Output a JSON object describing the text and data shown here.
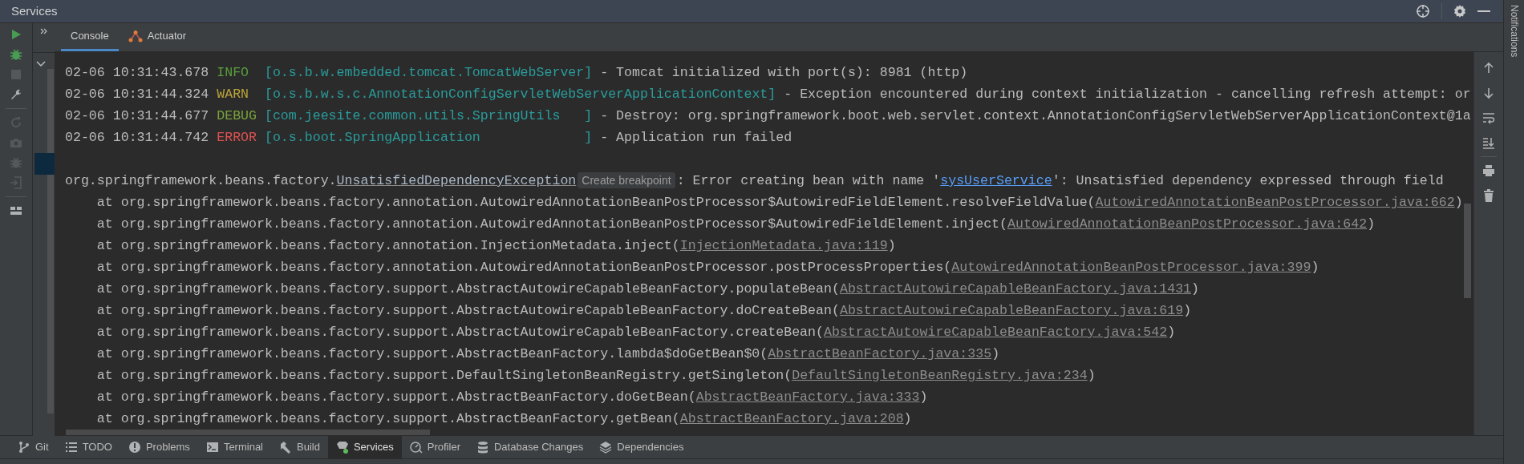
{
  "window": {
    "title": "Services"
  },
  "left_toolbar": [
    {
      "kind": "run",
      "disabled": false
    },
    {
      "kind": "debug",
      "disabled": false
    },
    {
      "kind": "stop",
      "disabled": true
    },
    {
      "kind": "wrench",
      "disabled": false
    },
    {
      "kind": "separator"
    },
    {
      "kind": "rerun",
      "disabled": true
    },
    {
      "kind": "camera",
      "disabled": true
    },
    {
      "kind": "debug",
      "disabled": true
    },
    {
      "kind": "import",
      "disabled": true
    },
    {
      "kind": "separator"
    },
    {
      "kind": "layout",
      "disabled": false
    }
  ],
  "tabs": [
    {
      "label": "Console",
      "kind": "console",
      "selected": true
    },
    {
      "label": "Actuator",
      "kind": "actuator",
      "selected": false
    }
  ],
  "console": {
    "lines": [
      {
        "kind": "log",
        "time": "02-06 10:31:43.678",
        "level": "INFO",
        "logger": "[o.s.b.w.embedded.tomcat.TomcatWebServer]",
        "message": "- Tomcat initialized with port(s): 8981 (http)"
      },
      {
        "kind": "log",
        "time": "02-06 10:31:44.324",
        "level": "WARN",
        "logger": "[o.s.b.w.s.c.AnnotationConfigServletWebServerApplicationContext]",
        "message": "- Exception encountered during context initialization - cancelling refresh attempt: or"
      },
      {
        "kind": "log",
        "time": "02-06 10:31:44.677",
        "level": "DEBUG",
        "logger": "[com.jeesite.common.utils.SpringUtils   ]",
        "message": "- Destroy: org.springframework.boot.web.servlet.context.AnnotationConfigServletWebServerApplicationContext@1a"
      },
      {
        "kind": "log",
        "time": "02-06 10:31:44.742",
        "level": "ERROR",
        "logger": "[o.s.boot.SpringApplication             ]",
        "message": "- Application run failed"
      },
      {
        "kind": "blank"
      },
      {
        "kind": "exception",
        "parts": [
          {
            "kind": "text",
            "text": "org.springframework.beans.factory."
          },
          {
            "kind": "class_link",
            "text": "UnsatisfiedDependencyException"
          },
          {
            "kind": "hint",
            "text": "Create breakpoint"
          },
          {
            "kind": "text",
            "text": ": Error creating bean with name '"
          },
          {
            "kind": "bean_link",
            "text": "sysUserService"
          },
          {
            "kind": "text",
            "text": "': Unsatisfied dependency expressed through field"
          }
        ]
      },
      {
        "kind": "frame",
        "prefix": "at org.springframework.beans.factory.annotation.AutowiredAnnotationBeanPostProcessor$AutowiredFieldElement.resolveFieldValue(",
        "link": "AutowiredAnnotationBeanPostProcessor.java:662",
        "suffix": ")"
      },
      {
        "kind": "frame",
        "prefix": "at org.springframework.beans.factory.annotation.AutowiredAnnotationBeanPostProcessor$AutowiredFieldElement.inject(",
        "link": "AutowiredAnnotationBeanPostProcessor.java:642",
        "suffix": ")"
      },
      {
        "kind": "frame",
        "prefix": "at org.springframework.beans.factory.annotation.InjectionMetadata.inject(",
        "link": "InjectionMetadata.java:119",
        "suffix": ")"
      },
      {
        "kind": "frame",
        "prefix": "at org.springframework.beans.factory.annotation.AutowiredAnnotationBeanPostProcessor.postProcessProperties(",
        "link": "AutowiredAnnotationBeanPostProcessor.java:399",
        "suffix": ")"
      },
      {
        "kind": "frame",
        "prefix": "at org.springframework.beans.factory.support.AbstractAutowireCapableBeanFactory.populateBean(",
        "link": "AbstractAutowireCapableBeanFactory.java:1431",
        "suffix": ")"
      },
      {
        "kind": "frame",
        "prefix": "at org.springframework.beans.factory.support.AbstractAutowireCapableBeanFactory.doCreateBean(",
        "link": "AbstractAutowireCapableBeanFactory.java:619",
        "suffix": ")"
      },
      {
        "kind": "frame",
        "prefix": "at org.springframework.beans.factory.support.AbstractAutowireCapableBeanFactory.createBean(",
        "link": "AbstractAutowireCapableBeanFactory.java:542",
        "suffix": ")"
      },
      {
        "kind": "frame",
        "prefix": "at org.springframework.beans.factory.support.AbstractBeanFactory.lambda$doGetBean$0(",
        "link": "AbstractBeanFactory.java:335",
        "suffix": ")"
      },
      {
        "kind": "frame",
        "prefix": "at org.springframework.beans.factory.support.DefaultSingletonBeanRegistry.getSingleton(",
        "link": "DefaultSingletonBeanRegistry.java:234",
        "suffix": ")"
      },
      {
        "kind": "frame",
        "prefix": "at org.springframework.beans.factory.support.AbstractBeanFactory.doGetBean(",
        "link": "AbstractBeanFactory.java:333",
        "suffix": ")"
      },
      {
        "kind": "frame",
        "prefix": "at org.springframework.beans.factory.support.AbstractBeanFactory.getBean(",
        "link": "AbstractBeanFactory.java:208",
        "suffix": ")"
      }
    ]
  },
  "side_label": "Notifications",
  "bottom_bar": [
    {
      "label": "Git",
      "kind": "git",
      "selected": false
    },
    {
      "label": "TODO",
      "kind": "todo",
      "selected": false
    },
    {
      "label": "Problems",
      "kind": "problems",
      "selected": false
    },
    {
      "label": "Terminal",
      "kind": "terminal",
      "selected": false
    },
    {
      "label": "Build",
      "kind": "build",
      "selected": false
    },
    {
      "label": "Services",
      "kind": "services",
      "selected": true
    },
    {
      "label": "Profiler",
      "kind": "profiler",
      "selected": false
    },
    {
      "label": "Database Changes",
      "kind": "database",
      "selected": false
    },
    {
      "label": "Dependencies",
      "kind": "dependencies",
      "selected": false
    }
  ]
}
